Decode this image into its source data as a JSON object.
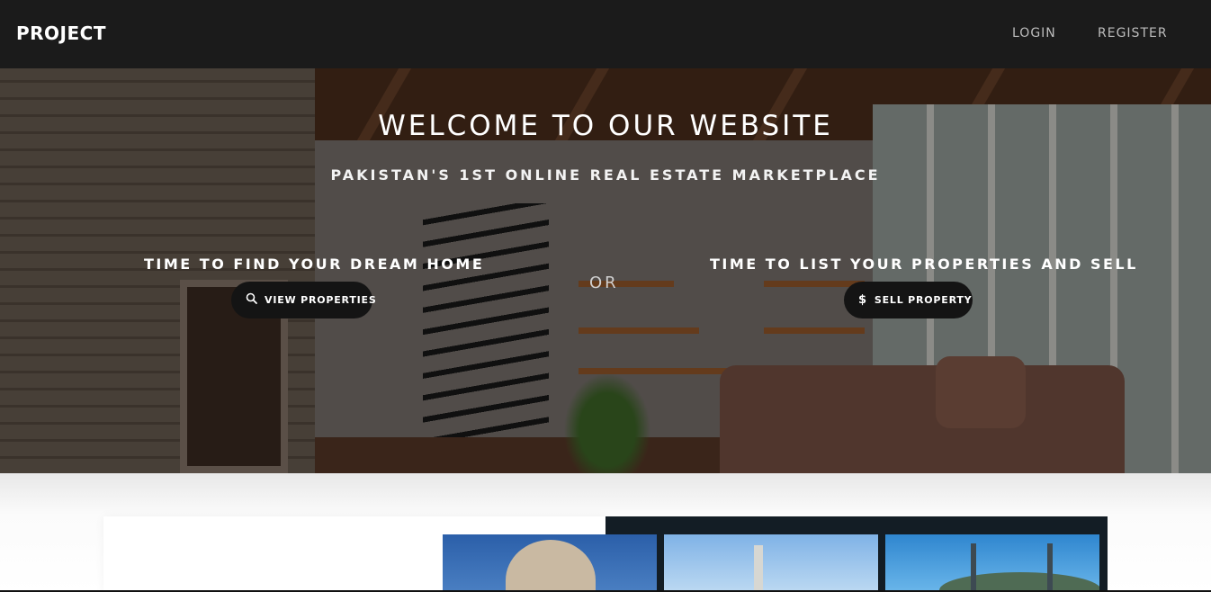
{
  "navbar": {
    "brand": "PROJECT",
    "links": {
      "login": "LOGIN",
      "register": "REGISTER"
    }
  },
  "hero": {
    "title": "WELCOME TO OUR WEBSITE",
    "subtitle": "PAKISTAN'S 1ST ONLINE REAL ESTATE MARKETPLACE",
    "find": {
      "heading": "TIME TO FIND YOUR DREAM HOME",
      "button_label": "VIEW PROPERTIES",
      "icon": "search-icon"
    },
    "separator": "OR",
    "sell": {
      "heading": "TIME TO LIST YOUR PROPERTIES AND SELL",
      "button_label": "SELL PROPERTY",
      "icon": "dollar-icon"
    }
  },
  "colors": {
    "navbar_bg": "#1b1b1b",
    "button_bg": "#141414",
    "dark_card": "#131d25"
  }
}
